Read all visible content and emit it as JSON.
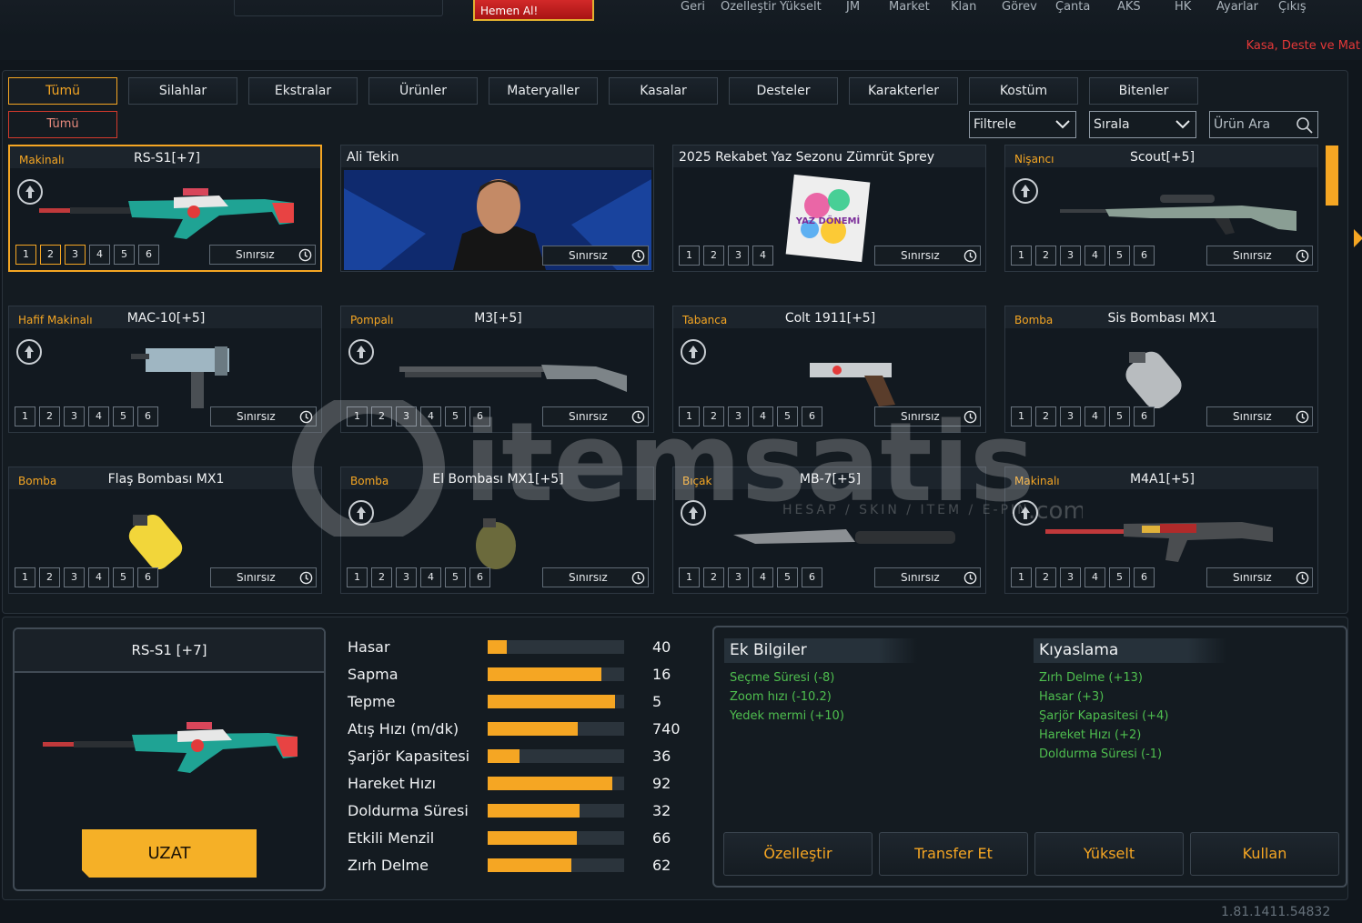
{
  "header": {
    "buy_now": "Hemen Al!",
    "nav": [
      "Geri",
      "Özelleştir",
      "Yükselt",
      "JM",
      "Market",
      "Klan",
      "Görev",
      "Çanta",
      "AKS",
      "HK",
      "Ayarlar",
      "Çıkış"
    ],
    "promo": "Kasa, Deste ve Mat"
  },
  "tabs": [
    "Tümü",
    "Silahlar",
    "Ekstralar",
    "Ürünler",
    "Materyaller",
    "Kasalar",
    "Desteler",
    "Karakterler",
    "Kostüm",
    "Bitenler"
  ],
  "subtab": "Tümü",
  "filter": {
    "label": "Filtrele"
  },
  "sort": {
    "label": "Sırala"
  },
  "search": {
    "placeholder": "Ürün Ara"
  },
  "expiry_label": "Sınırsız",
  "cards": [
    {
      "category": "Makinalı",
      "name": "RS-S1[+7]",
      "slots": [
        "1",
        "2",
        "3",
        "4",
        "5",
        "6"
      ],
      "active_slots": 3,
      "selected": true
    },
    {
      "category": "",
      "name": "Ali Tekin",
      "slots": [],
      "active_slots": 0
    },
    {
      "category": "",
      "name": "2025 Rekabet Yaz Sezonu Zümrüt Sprey",
      "slots": [
        "1",
        "2",
        "3",
        "4"
      ],
      "active_slots": 0,
      "image_text": "YAZ DÖNEMİ"
    },
    {
      "category": "Nişancı",
      "name": "Scout[+5]",
      "slots": [
        "1",
        "2",
        "3",
        "4",
        "5",
        "6"
      ],
      "active_slots": 0
    },
    {
      "category": "Hafif Makinalı",
      "name": "MAC-10[+5]",
      "slots": [
        "1",
        "2",
        "3",
        "4",
        "5",
        "6"
      ],
      "active_slots": 0
    },
    {
      "category": "Pompalı",
      "name": "M3[+5]",
      "slots": [
        "1",
        "2",
        "3",
        "4",
        "5",
        "6"
      ],
      "active_slots": 0
    },
    {
      "category": "Tabanca",
      "name": "Colt 1911[+5]",
      "slots": [
        "1",
        "2",
        "3",
        "4",
        "5",
        "6"
      ],
      "active_slots": 0
    },
    {
      "category": "Bomba",
      "name": "Sis Bombası MX1",
      "slots": [
        "1",
        "2",
        "3",
        "4",
        "5",
        "6"
      ],
      "active_slots": 0
    },
    {
      "category": "Bomba",
      "name": "Flaş Bombası MX1",
      "slots": [
        "1",
        "2",
        "3",
        "4",
        "5",
        "6"
      ],
      "active_slots": 0
    },
    {
      "category": "Bomba",
      "name": "El Bombası MX1[+5]",
      "slots": [
        "1",
        "2",
        "3",
        "4",
        "5",
        "6"
      ],
      "active_slots": 0
    },
    {
      "category": "Bıçak",
      "name": "MB-7[+5]",
      "slots": [
        "1",
        "2",
        "3",
        "4",
        "5",
        "6"
      ],
      "active_slots": 0
    },
    {
      "category": "Makinalı",
      "name": "M4A1[+5]",
      "slots": [
        "1",
        "2",
        "3",
        "4",
        "5",
        "6"
      ],
      "active_slots": 0
    }
  ],
  "watermark": {
    "brand": "itemsatis",
    "tagline": "HESAP / SKIN / ITEM / E-PIN",
    "suffix": ".com"
  },
  "detail": {
    "title": "RS-S1 [+7]",
    "extend_button": "UZAT",
    "stats": [
      {
        "label": "Hasar",
        "value": "40",
        "fill": 0.14
      },
      {
        "label": "Sapma",
        "value": "16",
        "fill": 0.83
      },
      {
        "label": "Tepme",
        "value": "5",
        "fill": 0.93
      },
      {
        "label": "Atış Hızı (m/dk)",
        "value": "740",
        "fill": 0.66
      },
      {
        "label": "Şarjör Kapasitesi",
        "value": "36",
        "fill": 0.23
      },
      {
        "label": "Hareket Hızı",
        "value": "92",
        "fill": 0.91
      },
      {
        "label": "Doldurma Süresi",
        "value": "32",
        "fill": 0.67
      },
      {
        "label": "Etkili Menzil",
        "value": "66",
        "fill": 0.65
      },
      {
        "label": "Zırh Delme",
        "value": "62",
        "fill": 0.61
      }
    ],
    "extra_info": {
      "title": "Ek Bilgiler",
      "items": [
        "Seçme Süresi (-8)",
        "Zoom hızı (-10.2)",
        "Yedek mermi (+10)"
      ]
    },
    "comparison": {
      "title": "Kıyaslama",
      "items": [
        "Zırh Delme (+13)",
        "Hasar (+3)",
        "Şarjör Kapasitesi (+4)",
        "Hareket Hızı (+2)",
        "Doldurma Süresi (-1)"
      ]
    },
    "actions": [
      "Özelleştir",
      "Transfer Et",
      "Yükselt",
      "Kullan"
    ]
  },
  "version": "1.81.1411.54832",
  "colors": {
    "accent": "#f5a623",
    "danger": "#e53838",
    "positive": "#4fbf4f",
    "background": "#10161c"
  }
}
